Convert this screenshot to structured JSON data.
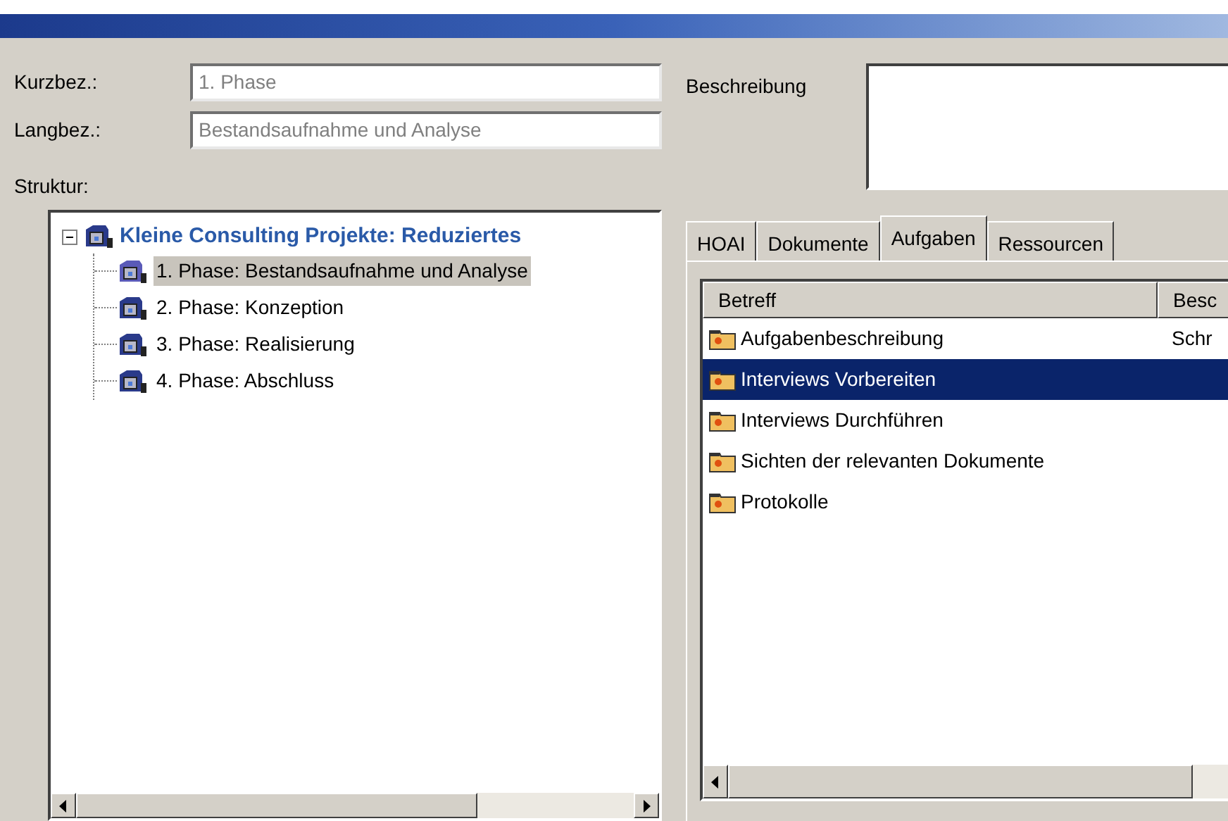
{
  "fields": [
    {
      "label": "Kurzbez.:",
      "value": "1. Phase"
    },
    {
      "label": "Langbez.:",
      "value": "Bestandsaufnahme und Analyse"
    }
  ],
  "description": {
    "label": "Beschreibung"
  },
  "structure": {
    "label": "Struktur:",
    "tree": [
      {
        "label": "Kleine Consulting Projekte: Reduziertes",
        "expanded": true,
        "selected": false,
        "children": [
          {
            "label": "1. Phase: Bestandsaufnahme und Analyse",
            "selected": true
          },
          {
            "label": "2. Phase: Konzeption",
            "selected": false
          },
          {
            "label": "3. Phase: Realisierung",
            "selected": false
          },
          {
            "label": "4. Phase: Abschluss",
            "selected": false
          }
        ]
      }
    ]
  },
  "tabs": [
    {
      "label": "HOAI",
      "selected": false
    },
    {
      "label": "Dokumente",
      "selected": false
    },
    {
      "label": "Aufgaben",
      "selected": true
    },
    {
      "label": "Ressourcen",
      "selected": false
    }
  ],
  "table": {
    "columns": [
      "Betreff",
      "Besc"
    ],
    "rows": [
      {
        "cells": [
          "Aufgabenbeschreibung",
          "Schr"
        ],
        "selected": false
      },
      {
        "cells": [
          "Interviews Vorbereiten"
        ],
        "selected": true
      },
      {
        "cells": [
          "Interviews Durchführen"
        ],
        "selected": false
      },
      {
        "cells": [
          "Sichten der relevanten Dokumente"
        ],
        "selected": false
      },
      {
        "cells": [
          "Protokolle"
        ],
        "selected": false
      }
    ]
  }
}
